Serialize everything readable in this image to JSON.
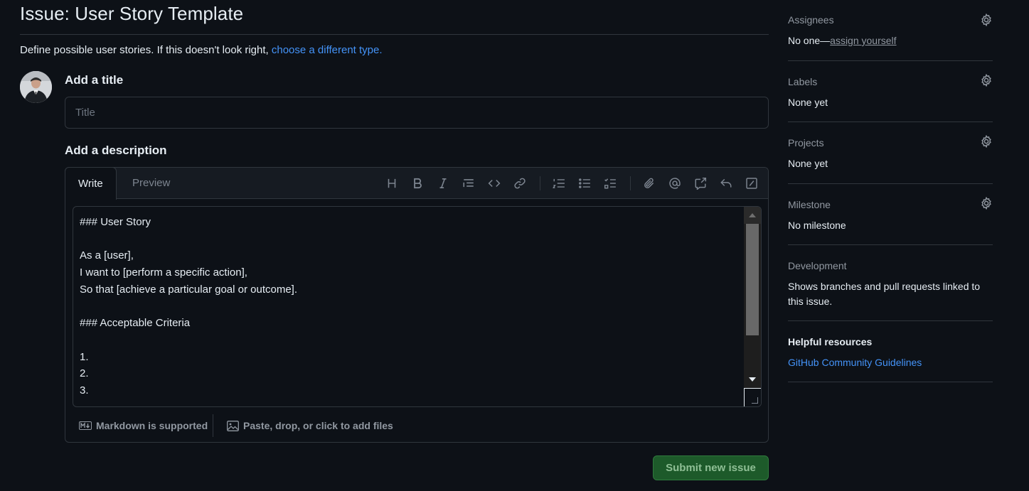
{
  "page": {
    "title": "Issue: User Story Template",
    "template_desc": "Define possible user stories. If this doesn't look right, ",
    "template_link": "choose a different type."
  },
  "form": {
    "title_label": "Add a title",
    "title_placeholder": "Title",
    "title_value": "",
    "description_label": "Add a description",
    "tabs": [
      {
        "label": "Write",
        "active": true
      },
      {
        "label": "Preview",
        "active": false
      }
    ],
    "toolbar_icons": [
      "heading-icon",
      "bold-icon",
      "italic-icon",
      "quote-icon",
      "code-icon",
      "link-icon",
      "numbered-list-icon",
      "unordered-list-icon",
      "task-list-icon",
      "attach-icon",
      "mention-icon",
      "reference-icon",
      "reply-icon",
      "slash-command-icon"
    ],
    "body_lines": [
      "### User Story",
      "",
      "As a [user],",
      "I want to [perform a specific action],",
      "So that [achieve a particular goal or outcome].",
      "",
      "### Acceptable Criteria",
      "",
      "1.",
      "2.",
      "3."
    ],
    "footer_markdown": "Markdown is supported",
    "footer_files": "Paste, drop, or click to add files",
    "submit_label": "Submit new issue"
  },
  "sidebar": {
    "assignees": {
      "heading": "Assignees",
      "value_prefix": "No one—",
      "value_link": "assign yourself"
    },
    "labels": {
      "heading": "Labels",
      "value": "None yet"
    },
    "projects": {
      "heading": "Projects",
      "value": "None yet"
    },
    "milestone": {
      "heading": "Milestone",
      "value": "No milestone"
    },
    "development": {
      "heading": "Development",
      "value": "Shows branches and pull requests linked to this issue."
    },
    "helpful": {
      "heading": "Helpful resources",
      "link": "GitHub Community Guidelines"
    }
  },
  "colors": {
    "background": "#0d1117",
    "link": "#4493f8",
    "submit_bg": "#1d5a2a"
  }
}
